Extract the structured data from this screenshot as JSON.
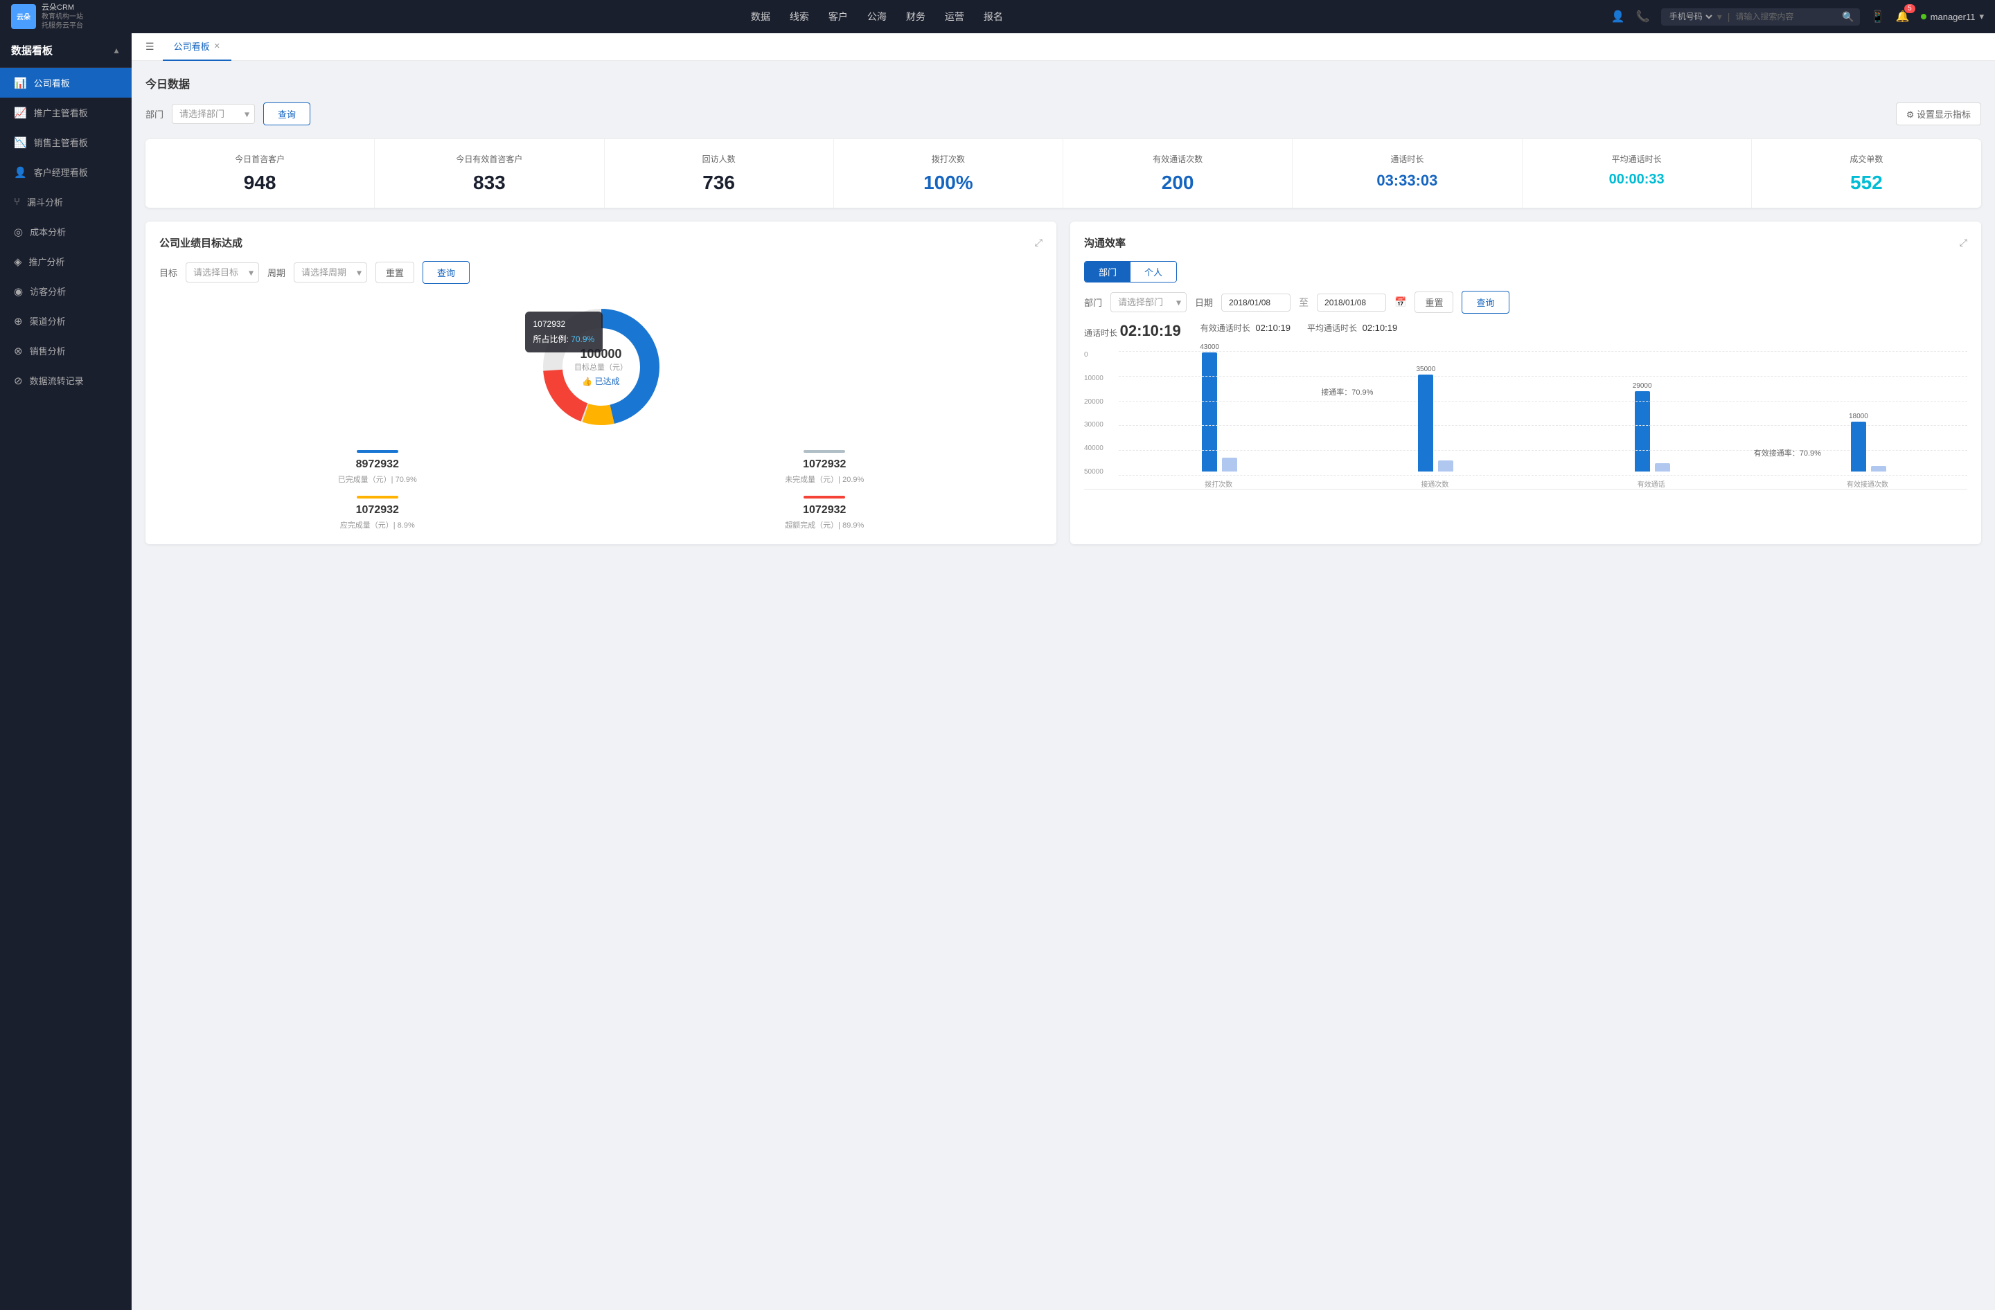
{
  "app": {
    "logo_text": "云朵CRM",
    "logo_sub": "教育机构一站\n托服务云平台"
  },
  "nav": {
    "items": [
      "数据",
      "线索",
      "客户",
      "公海",
      "财务",
      "运营",
      "报名"
    ]
  },
  "search": {
    "placeholder": "请输入搜索内容",
    "filter": "手机号码"
  },
  "user": {
    "name": "manager11",
    "notifications": "5"
  },
  "sidebar": {
    "title": "数据看板",
    "items": [
      {
        "label": "公司看板",
        "icon": "📊",
        "active": true
      },
      {
        "label": "推广主管看板",
        "icon": "📈"
      },
      {
        "label": "销售主管看板",
        "icon": "📉"
      },
      {
        "label": "客户经理看板",
        "icon": "👤"
      },
      {
        "label": "漏斗分析",
        "icon": "⑂"
      },
      {
        "label": "成本分析",
        "icon": "💰"
      },
      {
        "label": "推广分析",
        "icon": "📡"
      },
      {
        "label": "访客分析",
        "icon": "👁"
      },
      {
        "label": "渠道分析",
        "icon": "🔀"
      },
      {
        "label": "销售分析",
        "icon": "📊"
      },
      {
        "label": "数据流转记录",
        "icon": "🔄"
      }
    ]
  },
  "tabs": {
    "items": [
      {
        "label": "公司看板",
        "active": true
      }
    ]
  },
  "today_data": {
    "title": "今日数据",
    "filter_label": "部门",
    "filter_placeholder": "请选择部门",
    "btn_query": "查询",
    "btn_settings": "⚙ 设置显示指标",
    "stats": [
      {
        "label": "今日首咨客户",
        "value": "948",
        "color": "dark"
      },
      {
        "label": "今日有效首咨客户",
        "value": "833",
        "color": "dark"
      },
      {
        "label": "回访人数",
        "value": "736",
        "color": "dark"
      },
      {
        "label": "拨打次数",
        "value": "100%",
        "color": "blue"
      },
      {
        "label": "有效通话次数",
        "value": "200",
        "color": "blue"
      },
      {
        "label": "通话时长",
        "value": "03:33:03",
        "color": "blue"
      },
      {
        "label": "平均通话时长",
        "value": "00:00:33",
        "color": "cyan"
      },
      {
        "label": "成交单数",
        "value": "552",
        "color": "cyan"
      }
    ]
  },
  "goal_panel": {
    "title": "公司业绩目标达成",
    "filter_target_label": "目标",
    "filter_target_placeholder": "请选择目标",
    "filter_period_label": "周期",
    "filter_period_placeholder": "请选择周期",
    "btn_reset": "重置",
    "btn_query": "查询",
    "donut": {
      "center_value": "100000",
      "center_label": "目标总量（元）",
      "center_status": "👍 已达成",
      "tooltip_name": "1072932",
      "tooltip_pct": "70.9%"
    },
    "legend": [
      {
        "label": "已完成量（元）| 70.9%",
        "value": "8972932",
        "color": "#1976d2"
      },
      {
        "label": "未完成量（元）| 20.9%",
        "value": "1072932",
        "color": "#b0bec5"
      },
      {
        "label": "应完成量（元）| 8.9%",
        "value": "1072932",
        "color": "#ffb300"
      },
      {
        "label": "超额完成（元）| 89.9%",
        "value": "1072932",
        "color": "#f44336"
      }
    ]
  },
  "comm_panel": {
    "title": "沟通效率",
    "btn_dept": "部门",
    "btn_personal": "个人",
    "filter_dept_label": "部门",
    "filter_dept_placeholder": "请选择部门",
    "filter_date_label": "日期",
    "date_from": "2018/01/08",
    "date_to": "2018/01/08",
    "btn_reset": "重置",
    "btn_query": "查询",
    "time_stats": [
      {
        "label": "通话时长",
        "value": "02:10:19"
      },
      {
        "label": "有效通话时长",
        "value": "02:10:19"
      },
      {
        "label": "平均通话时长",
        "value": "02:10:19"
      }
    ],
    "chart": {
      "y_labels": [
        "0",
        "10000",
        "20000",
        "30000",
        "40000",
        "50000"
      ],
      "groups": [
        {
          "label": "拨打次数",
          "bars": [
            {
              "value": 43000,
              "label": "43000",
              "color": "blue"
            },
            {
              "value": 5000,
              "label": "",
              "color": "light-blue"
            }
          ]
        },
        {
          "label": "接通次数",
          "rate": "接通率：70.9%",
          "bars": [
            {
              "value": 35000,
              "label": "35000",
              "color": "blue"
            },
            {
              "value": 4000,
              "label": "",
              "color": "light-blue"
            }
          ]
        },
        {
          "label": "有效通话",
          "bars": [
            {
              "value": 29000,
              "label": "29000",
              "color": "blue"
            },
            {
              "value": 3000,
              "label": "",
              "color": "light-blue"
            }
          ]
        },
        {
          "label": "有效接通次数",
          "rate": "有效接通率：70.9%",
          "bars": [
            {
              "value": 18000,
              "label": "18000",
              "color": "blue"
            },
            {
              "value": 2000,
              "label": "",
              "color": "light-blue"
            }
          ]
        }
      ]
    }
  }
}
